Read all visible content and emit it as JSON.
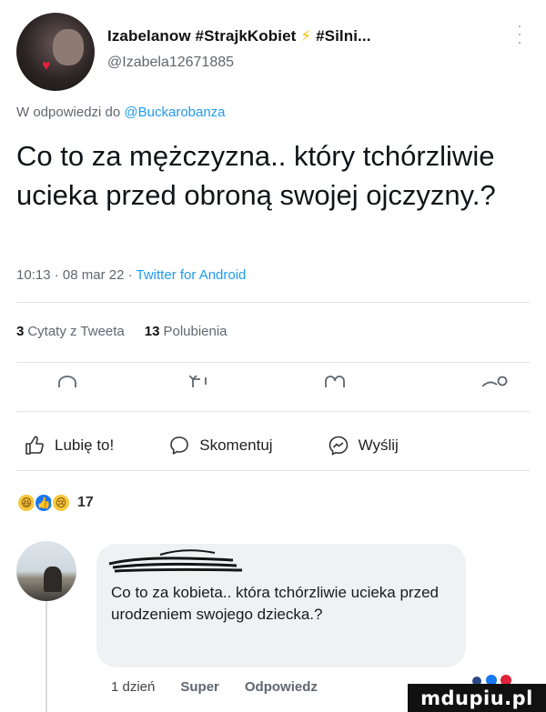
{
  "tweet": {
    "display_name": "Izabelanow #StrajkKobiet ",
    "bolt": "⚡",
    "display_name_tail": "#Silni...",
    "handle": "@Izabela12671885",
    "reply_prefix": "W odpowiedzi do ",
    "reply_mention": "@Buckarobanza",
    "text": "Co to za mężczyzna.. który tchórzliwie ucieka przed obroną swojej ojczyzny.?",
    "time": "10:13",
    "date": "08 mar 22",
    "client": "Twitter for Android",
    "sep": "·",
    "quotes_count": "3",
    "quotes_label": "Cytaty z Tweeta",
    "likes_count": "13",
    "likes_label": "Polubienia"
  },
  "facebook": {
    "like_label": "Lubię to!",
    "comment_label": "Skomentuj",
    "share_label": "Wyślij",
    "reaction_count": "17",
    "reactions": [
      "haha",
      "like",
      "sad"
    ]
  },
  "comment": {
    "author": "",
    "text": "Co to za kobieta.. która tchórzliwie ucieka przed urodzeniem swojego dziecka.?",
    "time": "1 dzień",
    "like_action": "Super",
    "reply_action": "Odpowiedz"
  },
  "watermark": "mdupiu.pl",
  "colors": {
    "link": "#1d9bf0",
    "muted": "#5f6770",
    "bubble": "#eff1f3"
  }
}
